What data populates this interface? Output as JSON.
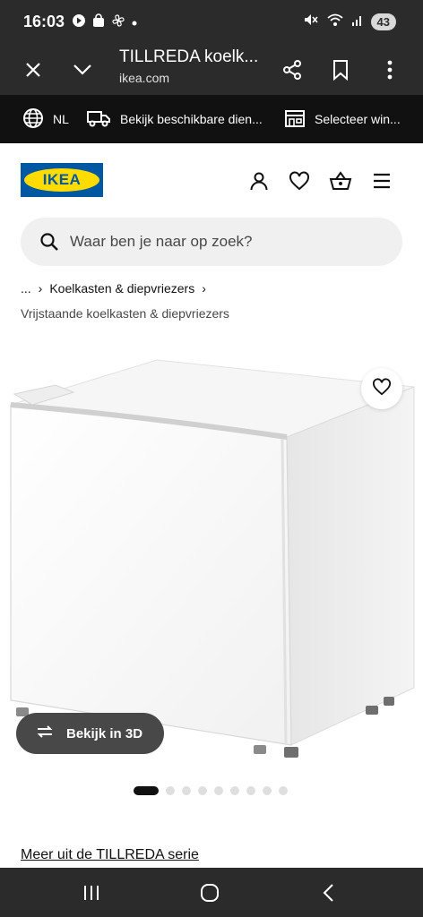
{
  "status_bar": {
    "time": "16:03",
    "battery": "43",
    "icons_left": [
      "play-icon",
      "shopping-bag-icon",
      "fan-icon",
      "dot-icon"
    ],
    "icons_right": [
      "mute-icon",
      "wifi-icon",
      "signal-icon",
      "battery-icon"
    ]
  },
  "browser": {
    "title": "TILLREDA koelk...",
    "url": "ikea.com",
    "actions": [
      "close-icon",
      "chevron-down-icon",
      "share-icon",
      "bookmark-icon",
      "more-icon"
    ]
  },
  "info_strip": {
    "language": "NL",
    "delivery": "Bekijk beschikbare dien...",
    "store": "Selecteer win..."
  },
  "header": {
    "logo_text": "IKEA",
    "icons": [
      "profile-icon",
      "heart-icon",
      "basket-icon",
      "menu-icon"
    ]
  },
  "search": {
    "placeholder": "Waar ben je naar op zoek?"
  },
  "breadcrumb": {
    "ellipsis": "...",
    "item": "Koelkasten & diepvriezers",
    "sub": "Vrijstaande koelkasten & diepvriezers"
  },
  "product": {
    "view3d_label": "Bekijk in 3D",
    "image_count": 9,
    "active_image": 1,
    "series_link": "Meer uit de TILLREDA serie"
  },
  "colors": {
    "status_bg": "#2b2b2b",
    "strip_bg": "#111111",
    "ikea_blue": "#0058a3",
    "ikea_yellow": "#ffdb00",
    "search_bg": "#f0f0f0"
  }
}
